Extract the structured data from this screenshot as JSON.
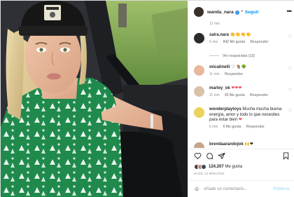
{
  "post": {
    "username": "wanda_nara",
    "follow_label": "Seguir",
    "separator": "•",
    "caption_time": "12 min",
    "more_icon": "more-dots-icon"
  },
  "comments": [
    {
      "user": "zaira.nara",
      "text": "👏👏👏👏",
      "time": "6 min",
      "likes": "842 Me gusta",
      "reply": "Responder",
      "view_replies": "Ver respuestas (13)"
    },
    {
      "user": "micatinelli",
      "text": "♡ 🐐🌳",
      "time": "11 min",
      "likes": "",
      "reply": "Responder"
    },
    {
      "user": "marley_ok",
      "text": "❤❤❤",
      "time": "11 min",
      "likes": "93 Me gusta",
      "reply": "Responder"
    },
    {
      "user": "wonderplaytoys",
      "text": "Mucha mucha buena energía, amor y todo lo que necesites para estar bien",
      "text_emoji": "❤",
      "time": "6 min",
      "likes": "6 Me gusta",
      "reply": "Responder"
    },
    {
      "user": "brendaarandojok",
      "text": "🙌❤",
      "time": "",
      "likes": "",
      "reply": ""
    }
  ],
  "actions": {
    "like_icon": "heart-icon",
    "comment_icon": "comment-icon",
    "share_icon": "share-icon",
    "save_icon": "bookmark-icon"
  },
  "likes": {
    "count": "124.207",
    "label": "Me gusta"
  },
  "post_time": "HACE 12 MINUTOS",
  "add_comment": {
    "emoji_icon": "smiley-icon",
    "placeholder": "Añade un comentario...",
    "publish_label": "Publicar"
  },
  "colors": {
    "accent_blue": "#0095f6",
    "heart_red": "#ed4956",
    "jersey_green": "#1f8a4c"
  }
}
